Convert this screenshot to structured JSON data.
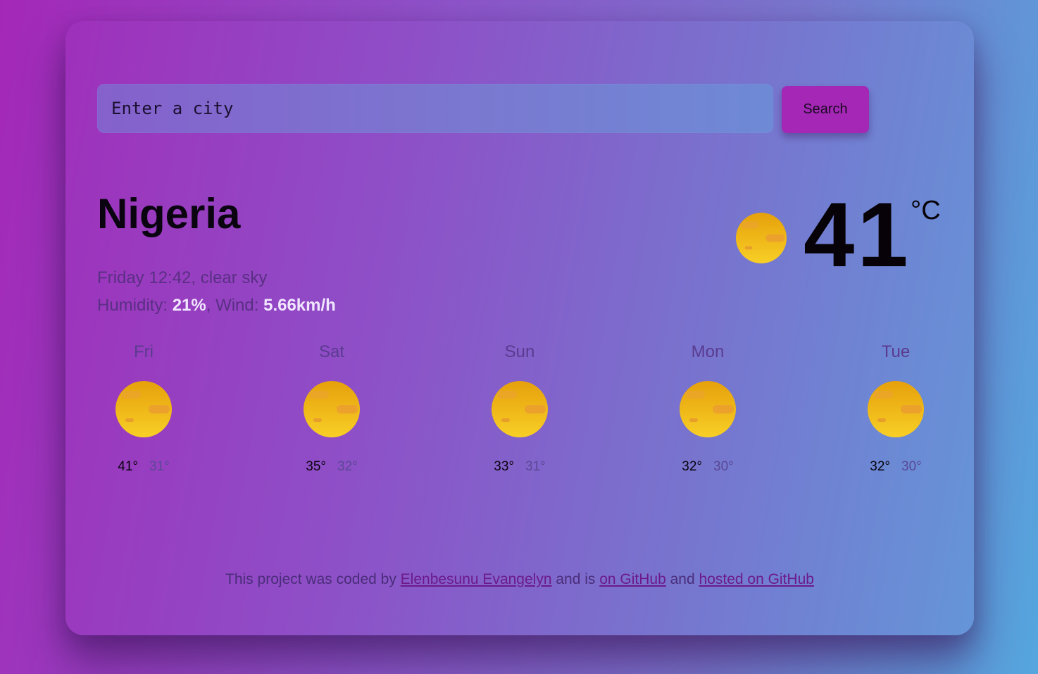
{
  "search": {
    "placeholder": "Enter a city",
    "button_label": "Search"
  },
  "current": {
    "city": "Nigeria",
    "day_time_description": "Friday 12:42, clear sky",
    "humidity_label": "Humidity: ",
    "humidity_value": "21%",
    "wind_label": ", Wind: ",
    "wind_value": "5.66km/h",
    "temperature": "41",
    "unit": "°C",
    "icon": "sun-icon"
  },
  "forecast": [
    {
      "day": "Fri",
      "max": "41°",
      "min": "31°",
      "icon": "sun-icon"
    },
    {
      "day": "Sat",
      "max": "35°",
      "min": "32°",
      "icon": "sun-icon"
    },
    {
      "day": "Sun",
      "max": "33°",
      "min": "31°",
      "icon": "sun-icon"
    },
    {
      "day": "Mon",
      "max": "32°",
      "min": "30°",
      "icon": "sun-icon"
    },
    {
      "day": "Tue",
      "max": "32°",
      "min": "30°",
      "icon": "sun-icon"
    }
  ],
  "footer": {
    "text1": "This project was coded by ",
    "author_link": "Elenbesunu Evangelyn",
    "text2": " and is ",
    "github_link": "on GitHub",
    "text3": " and ",
    "hosted_link": "hosted on GitHub"
  },
  "colors": {
    "accent_button": "#a527b6",
    "sun_top": "#e8a20a",
    "sun_bottom": "#f7cc25"
  }
}
